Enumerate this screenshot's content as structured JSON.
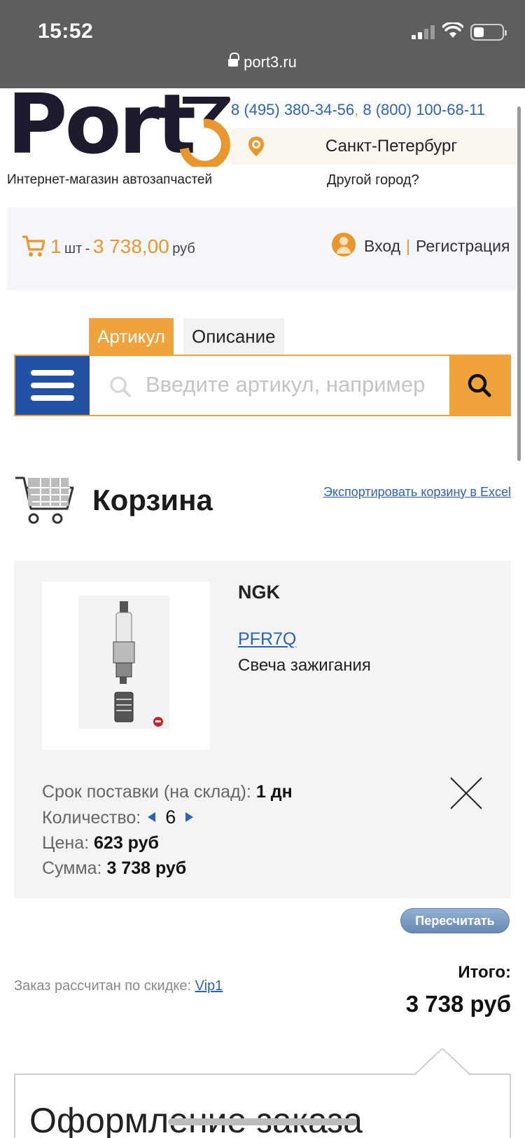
{
  "status": {
    "time": "15:52"
  },
  "browser": {
    "url": "port3.ru"
  },
  "header": {
    "logo_text": "Port3",
    "tagline": "Интернет-магазин автозапчастей",
    "phone1": "8 (495) 380-34-56",
    "phone_sep": ",",
    "phone2": "8 (800) 100-68-11",
    "city": "Санкт-Петербург",
    "other_city": "Другой город?"
  },
  "cartbar": {
    "count": "1",
    "unit": "шт",
    "dash": "-",
    "amount": "3 738,00",
    "currency": "руб",
    "login": "Вход",
    "register": "Регистрация"
  },
  "search": {
    "tab_article": "Артикул",
    "tab_description": "Описание",
    "placeholder": "Введите артикул, например"
  },
  "cart": {
    "title": "Корзина",
    "export_label": "Экспортировать корзину в Excel",
    "item": {
      "brand": "NGK",
      "code": "PFR7Q",
      "name": "Свеча зажигания",
      "delivery_label": "Срок поставки (на склад):",
      "delivery_value": "1 дн",
      "qty_label": "Количество:",
      "qty_value": "6",
      "price_label": "Цена:",
      "price_value": "623 руб",
      "sum_label": "Сумма:",
      "sum_value": "3 738 руб"
    },
    "recalc_label": "Пересчитать",
    "discount_label": "Заказ рассчитан по скидке:",
    "discount_value": "Vip1",
    "total_label": "Итого:",
    "total_value": "3 738 руб"
  },
  "checkout": {
    "title": "Оформление заказа"
  },
  "colors": {
    "accent": "#f0a33a",
    "brand_blue": "#2352a5",
    "link": "#2d63b3"
  }
}
